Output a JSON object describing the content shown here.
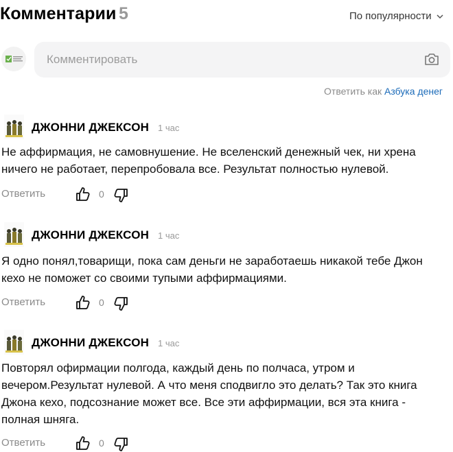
{
  "header": {
    "title": "Комментарии",
    "count": "5",
    "sort_label": "По популярности"
  },
  "composer": {
    "placeholder": "Комментировать",
    "reply_as_prefix": "Ответить как ",
    "reply_as_name": "Азбука денег"
  },
  "colors": {
    "link": "#1a6ab8",
    "muted": "#8a8a8a",
    "composer_bg": "#f4f4f5"
  },
  "icons": {
    "sort": "chevron-down-icon",
    "attach": "camera-icon",
    "like": "thumb-up-icon",
    "dislike": "thumb-down-icon"
  },
  "comments": [
    {
      "author": "ДЖОННИ ДЖЕКСОН",
      "time": "1 час",
      "text": "Не аффирмация, не самовнушение. Не вселенский денежный чек, ни хрена ничего не работает, перепробовала все. Результат полностью нулевой.",
      "reply_label": "Ответить",
      "likes": "0"
    },
    {
      "author": "ДЖОННИ ДЖЕКСОН",
      "time": "1 час",
      "text": "Я одно понял,товарищи, пока сам деньги не заработаешь никакой тебе Джон кехо не поможет со своими тупыми аффирмациями.",
      "reply_label": "Ответить",
      "likes": "0"
    },
    {
      "author": "ДЖОННИ ДЖЕКСОН",
      "time": "1 час",
      "text": "Повторял офирмации полгода, каждый день по полчаса, утром и вечером.Результат нулевой. А что меня сподвигло это делать? Так это книга Джона кехо, подсознание может все. Все эти аффирмации, вся эта книга - полная шняга.",
      "reply_label": "Ответить",
      "likes": "0"
    }
  ]
}
